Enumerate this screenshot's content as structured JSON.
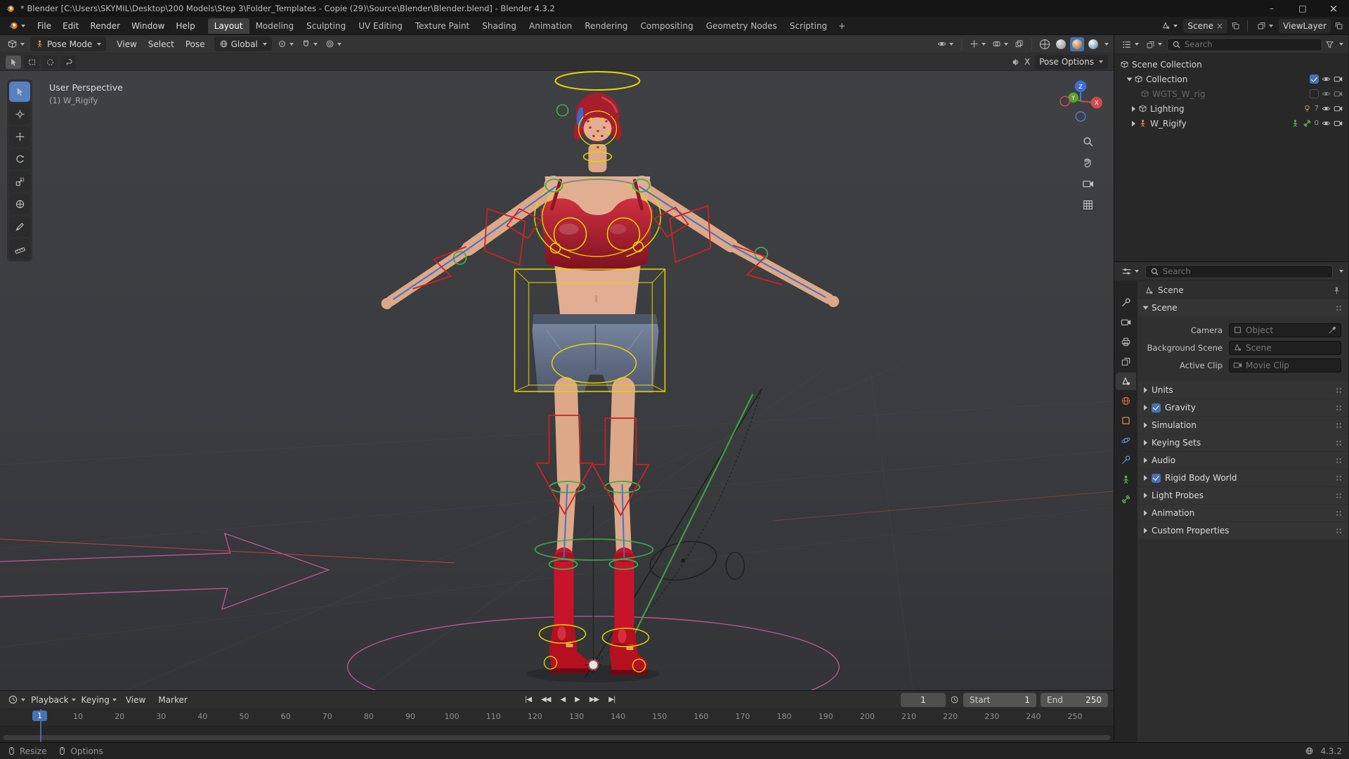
{
  "titlebar": {
    "title": "* Blender [C:\\Users\\SKYMIL\\Desktop\\200 Models\\Step 3\\Folder_Templates - Copie (29)\\Source\\Blender\\Blender.blend] - Blender 4.3.2",
    "minimize": "–",
    "maximize": "□",
    "close": "×"
  },
  "topbar": {
    "menus": [
      "File",
      "Edit",
      "Render",
      "Window",
      "Help"
    ],
    "workspaces": [
      "Layout",
      "Modeling",
      "Sculpting",
      "UV Editing",
      "Texture Paint",
      "Shading",
      "Animation",
      "Rendering",
      "Compositing",
      "Geometry Nodes",
      "Scripting"
    ],
    "active_workspace": "Layout",
    "add_workspace": "+",
    "scene_label": "Scene",
    "scene_unlink": "×",
    "viewlayer_label": "ViewLayer"
  },
  "viewport": {
    "mode": "Pose Mode",
    "menus": [
      "View",
      "Select",
      "Pose"
    ],
    "orientation": "Global",
    "mirror_x": "X",
    "pose_options": "Pose Options",
    "overlay_line1": "User Perspective",
    "overlay_line2": "(1) W_Rigify",
    "gizmo": {
      "x": "X",
      "y": "Y",
      "z": "Z"
    }
  },
  "outliner": {
    "search_placeholder": "Search",
    "rows": [
      {
        "label": "Scene Collection"
      },
      {
        "label": "Collection"
      },
      {
        "label": "WGTS_W_rig"
      },
      {
        "label": "Lighting",
        "count": "7"
      },
      {
        "label": "W_Rigify",
        "count": "0"
      }
    ]
  },
  "properties": {
    "search_placeholder": "Search",
    "breadcrumb": "Scene",
    "scene_panel": {
      "title": "Scene",
      "camera_label": "Camera",
      "camera_value": "Object",
      "background_label": "Background Scene",
      "background_value": "Scene",
      "clip_label": "Active Clip",
      "clip_value": "Movie Clip"
    },
    "panels": [
      {
        "label": "Units"
      },
      {
        "label": "Gravity",
        "checked": true
      },
      {
        "label": "Simulation"
      },
      {
        "label": "Keying Sets"
      },
      {
        "label": "Audio"
      },
      {
        "label": "Rigid Body World",
        "checked": true
      },
      {
        "label": "Light Probes"
      },
      {
        "label": "Animation"
      },
      {
        "label": "Custom Properties"
      }
    ]
  },
  "timeline": {
    "menus": [
      "Playback",
      "Keying",
      "View",
      "Marker"
    ],
    "transport": [
      "|◀",
      "◀◀",
      "◀",
      "▶",
      "▶▶",
      "▶|"
    ],
    "current_frame": "1",
    "marker_frame": "1",
    "start_label": "Start",
    "start_value": "1",
    "end_label": "End",
    "end_value": "250",
    "ticks": [
      "10",
      "20",
      "30",
      "40",
      "50",
      "60",
      "70",
      "80",
      "90",
      "100",
      "110",
      "120",
      "130",
      "140",
      "150",
      "160",
      "170",
      "180",
      "190",
      "200",
      "210",
      "220",
      "230",
      "240",
      "250"
    ]
  },
  "statusbar": {
    "resize": "Resize",
    "options": "Options",
    "version": "4.3.2"
  },
  "colors": {
    "accent": "#4772b3",
    "rig_yellow": "#e7d500",
    "rig_red": "#cc2222",
    "rig_green": "#3fae4e",
    "rig_blue": "#3f6fd0",
    "rig_pink": "#d159a2"
  }
}
